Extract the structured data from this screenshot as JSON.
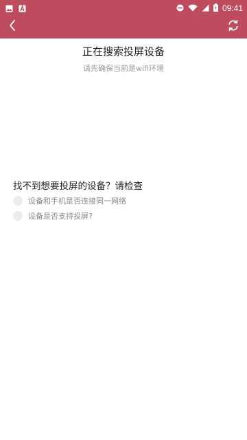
{
  "colors": {
    "accent": "#bf4b5f",
    "subtitle": "#9a9a9a",
    "label": "#8a8a8a",
    "check": "#ececec"
  },
  "status_bar": {
    "left_icons": [
      "image-icon",
      "a-notification-icon"
    ],
    "right_icons": [
      "do-not-disturb-icon",
      "wifi-icon",
      "signal-icon",
      "battery-charging-icon"
    ],
    "time": "09:41"
  },
  "toolbar": {
    "back_icon": "chevron-left-icon",
    "refresh_icon": "refresh-icon"
  },
  "main": {
    "title": "正在搜索投屏设备",
    "subtitle": "请先确保当前是wifi环境"
  },
  "help": {
    "title": "找不到想要投屏的设备？请检查",
    "items": [
      {
        "label": "设备和手机是否连接同一网络"
      },
      {
        "label": "设备是否支持投屏?"
      }
    ]
  }
}
